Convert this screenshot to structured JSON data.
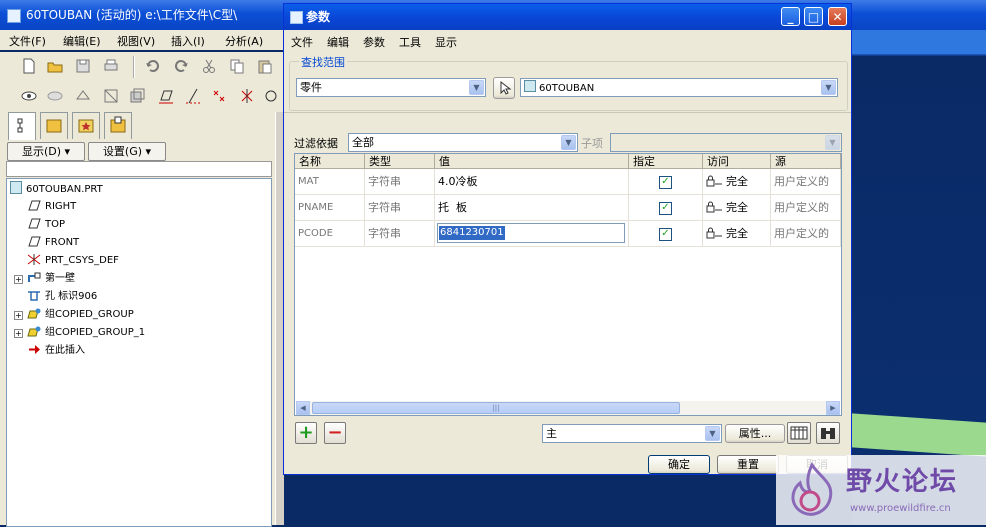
{
  "main_window": {
    "title": "60TOUBAN (活动的) e:\\工作文件\\C型\\",
    "menu": [
      "文件(F)",
      "编辑(E)",
      "视图(V)",
      "插入(I)",
      "分析(A)"
    ]
  },
  "model_tree": {
    "show_button": "显示(D) ▾",
    "settings_button": "设置(G) ▾",
    "root": "60TOUBAN.PRT",
    "items": [
      {
        "label": "RIGHT",
        "icon": "datum-plane-icon"
      },
      {
        "label": "TOP",
        "icon": "datum-plane-icon"
      },
      {
        "label": "FRONT",
        "icon": "datum-plane-icon"
      },
      {
        "label": "PRT_CSYS_DEF",
        "icon": "coordinate-system-icon"
      },
      {
        "label": "第一壁",
        "icon": "sheetmetal-wall-icon"
      },
      {
        "label": "孔 标识906",
        "icon": "hole-icon"
      },
      {
        "label": "组COPIED_GROUP",
        "icon": "group-icon"
      },
      {
        "label": "组COPIED_GROUP_1",
        "icon": "group-icon"
      },
      {
        "label": "在此插入",
        "icon": "insert-here-arrow-icon"
      }
    ]
  },
  "dialog": {
    "title": "参数",
    "menu": [
      "文件",
      "编辑",
      "参数",
      "工具",
      "显示"
    ],
    "lookup_group_label": "查找范围",
    "scope_type": "零件",
    "scope_object": "60TOUBAN",
    "filter_label": "过滤依据",
    "filter_value": "全部",
    "subitem_label": "子项",
    "columns": [
      "名称",
      "类型",
      "值",
      "指定",
      "访问",
      "源"
    ],
    "rows": [
      {
        "name": "MAT",
        "type": "字符串",
        "value": "4.0冷板",
        "designated": true,
        "access": "完全",
        "source": "用户定义的"
      },
      {
        "name": "PNAME",
        "type": "字符串",
        "value": "托  板",
        "designated": true,
        "access": "完全",
        "source": "用户定义的"
      },
      {
        "name": "PCODE",
        "type": "字符串",
        "value": "6841230701",
        "designated": true,
        "access": "完全",
        "source": "用户定义的"
      }
    ],
    "add_symbol": "+",
    "remove_symbol": "−",
    "main_select": "主",
    "properties_button": "属性...",
    "ok_button": "确定",
    "reset_button": "重置",
    "cancel_button": "取消"
  },
  "watermark": {
    "title": "野火论坛",
    "url": "www.proewildfire.cn"
  }
}
